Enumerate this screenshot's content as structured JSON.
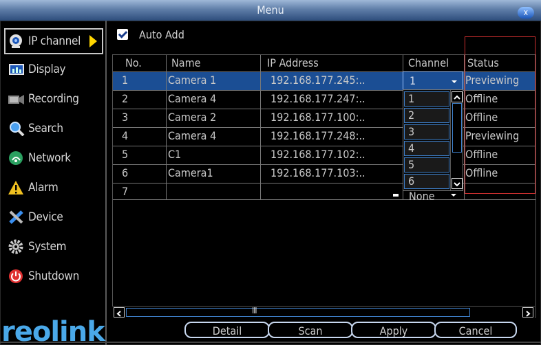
{
  "window": {
    "title": "Menu",
    "close_label": "x"
  },
  "sidebar": {
    "items": [
      {
        "label": "IP channel",
        "icon": "camera-icon",
        "active": true
      },
      {
        "label": "Display",
        "icon": "display-icon"
      },
      {
        "label": "Recording",
        "icon": "recording-icon"
      },
      {
        "label": "Search",
        "icon": "search-icon"
      },
      {
        "label": "Network",
        "icon": "network-icon"
      },
      {
        "label": "Alarm",
        "icon": "alarm-icon"
      },
      {
        "label": "Device",
        "icon": "device-icon"
      },
      {
        "label": "System",
        "icon": "gear-icon"
      },
      {
        "label": "Shutdown",
        "icon": "power-icon"
      }
    ],
    "logo_text": "reolink"
  },
  "auto_add": {
    "label": "Auto Add",
    "checked": true
  },
  "table": {
    "headers": [
      "No.",
      "Name",
      "IP Address",
      "Channel",
      "Status"
    ],
    "rows": [
      {
        "no": "1",
        "name": "Camera 1",
        "ip": "192.168.177.245:..",
        "channel": "1",
        "status": "Previewing",
        "selected": true
      },
      {
        "no": "2",
        "name": "Camera 4",
        "ip": "192.168.177.247:..",
        "channel": "",
        "status": "Offline"
      },
      {
        "no": "3",
        "name": "Camera 2",
        "ip": "192.168.177.100:..",
        "channel": "",
        "status": "Offline"
      },
      {
        "no": "4",
        "name": "Camera 4",
        "ip": "192.168.177.248:..",
        "channel": "",
        "status": "Previewing"
      },
      {
        "no": "5",
        "name": "C1",
        "ip": "192.168.177.102:..",
        "channel": "",
        "status": "Offline"
      },
      {
        "no": "6",
        "name": "Camera1",
        "ip": "192.168.177.103:..",
        "channel": "",
        "status": "Offline"
      },
      {
        "no": "7",
        "name": "",
        "ip": "",
        "channel": "None",
        "status": ""
      }
    ]
  },
  "channel_dropdown": {
    "selected": "1",
    "options": [
      "1",
      "2",
      "3",
      "4",
      "5",
      "6"
    ]
  },
  "hscroll": {
    "grip": "III"
  },
  "buttons": {
    "detail": "Detail",
    "scan": "Scan",
    "apply": "Apply",
    "cancel": "Cancel"
  },
  "colors": {
    "selection": "#1b4e94",
    "accent": "#3e7fc8",
    "highlight_box": "#d03030",
    "logo": "#4aa8e8"
  }
}
